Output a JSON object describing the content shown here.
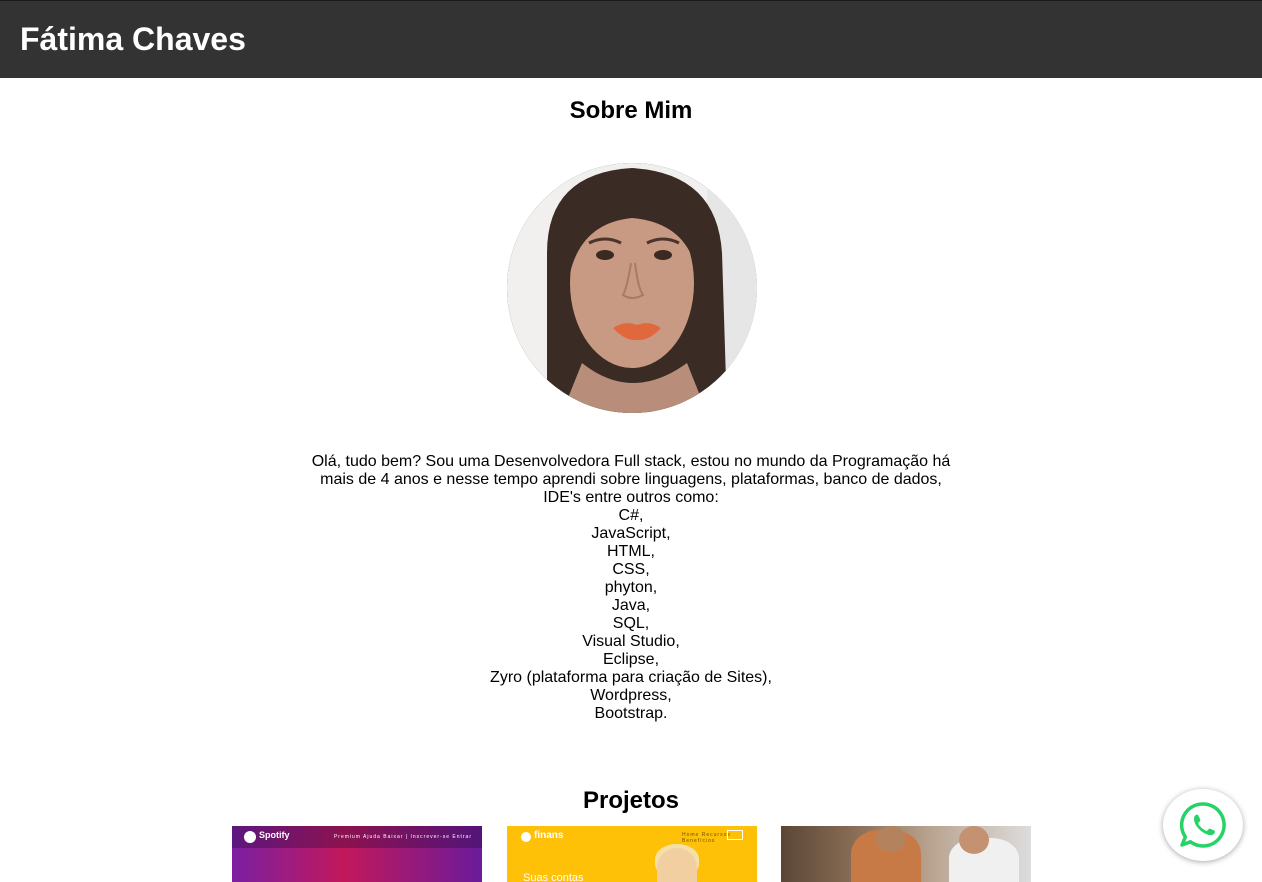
{
  "header": {
    "site_title": "Fátima Chaves"
  },
  "about": {
    "title": "Sobre Mim",
    "photo_alt": "Fátima Chaves",
    "intro": "Olá, tudo bem? Sou uma Desenvolvedora Full stack, estou no mundo da Programação há mais de 4 anos e nesse tempo aprendi sobre linguagens, plataformas, banco de dados, IDE's entre outros como:",
    "skills": [
      "C#,",
      "JavaScript,",
      "HTML,",
      "CSS,",
      "phyton,",
      "Java,",
      "SQL,",
      "Visual Studio,",
      "Eclipse,",
      "Zyro (plataforma para criação de Sites),",
      "Wordpress,",
      "Bootstrap."
    ]
  },
  "projects": {
    "title": "Projetos",
    "items": [
      {
        "brand": "Spotify",
        "nav": "Premium Ajuda Baixar | Inscrever-se Entrar",
        "accent": "#7a1fa2"
      },
      {
        "brand": "finans",
        "nav": "Home Recursos Benefícios",
        "tagline": "Suas contas",
        "accent": "#ffc107"
      },
      {
        "accent": "#6d5a4a"
      }
    ]
  },
  "whatsapp": {
    "icon": "whatsapp-icon",
    "color": "#25d366"
  },
  "colors": {
    "header_bg": "#333333",
    "header_text": "#ffffff"
  }
}
